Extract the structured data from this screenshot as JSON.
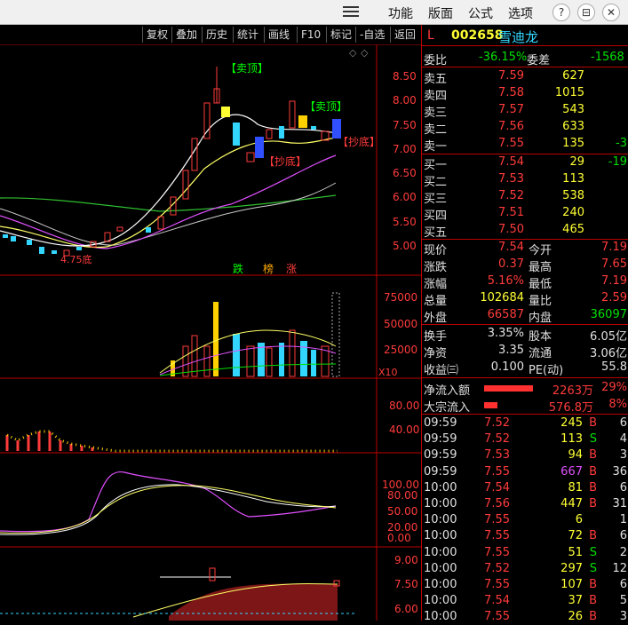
{
  "menu": {
    "items": [
      "功能",
      "版面",
      "公式",
      "选项"
    ],
    "window_buttons": [
      "?",
      "⊟",
      "⊠",
      "✕"
    ]
  },
  "toolbar": {
    "buttons": [
      "复权",
      "叠加",
      "历史",
      "统计",
      "画线",
      "F10",
      "标记",
      "-自选",
      "返回"
    ]
  },
  "stock": {
    "flag": "L",
    "code": "002658",
    "name": "雪迪龙"
  },
  "main_chart": {
    "y_ticks": [
      "8.50",
      "8.00",
      "7.50",
      "7.00",
      "6.50",
      "6.00",
      "5.50",
      "5.00"
    ],
    "annotations": {
      "sell_top_1": "【卖顶】",
      "sell_top_2": "【卖顶】",
      "buy_bottom_1": "【抄底】",
      "buy_bottom_2": "【抄底】",
      "low_mark": "4.75底"
    },
    "tags": [
      "跌",
      "榜",
      "涨"
    ]
  },
  "volume_chart": {
    "y_ticks": [
      "75000",
      "50000",
      "25000"
    ],
    "unit": "X10"
  },
  "indicator1": {
    "y_ticks": [
      "80.00",
      "40.00"
    ]
  },
  "indicator2": {
    "y_ticks": [
      "100.00",
      "80.00",
      "50.00",
      "20.00",
      "0.00"
    ]
  },
  "indicator3": {
    "y_ticks": [
      "9.00",
      "7.50",
      "6.00"
    ]
  },
  "quote": {
    "commission_ratio_label": "委比",
    "commission_ratio": "-36.15%",
    "commission_diff_label": "委差",
    "commission_diff": "-1568",
    "asks": [
      {
        "label": "卖五",
        "price": "7.59",
        "vol": "627",
        "chg": ""
      },
      {
        "label": "卖四",
        "price": "7.58",
        "vol": "1015",
        "chg": ""
      },
      {
        "label": "卖三",
        "price": "7.57",
        "vol": "543",
        "chg": ""
      },
      {
        "label": "卖二",
        "price": "7.56",
        "vol": "633",
        "chg": ""
      },
      {
        "label": "卖一",
        "price": "7.55",
        "vol": "135",
        "chg": "-3"
      }
    ],
    "bids": [
      {
        "label": "买一",
        "price": "7.54",
        "vol": "29",
        "chg": "-19"
      },
      {
        "label": "买二",
        "price": "7.53",
        "vol": "113",
        "chg": ""
      },
      {
        "label": "买三",
        "price": "7.52",
        "vol": "538",
        "chg": ""
      },
      {
        "label": "买四",
        "price": "7.51",
        "vol": "240",
        "chg": ""
      },
      {
        "label": "买五",
        "price": "7.50",
        "vol": "465",
        "chg": ""
      }
    ],
    "stats": [
      {
        "l1": "现价",
        "v1": "7.54",
        "l2": "今开",
        "v2": "7.19"
      },
      {
        "l1": "涨跌",
        "v1": "0.37",
        "l2": "最高",
        "v2": "7.65"
      },
      {
        "l1": "涨幅",
        "v1": "5.16%",
        "l2": "最低",
        "v2": "7.19"
      },
      {
        "l1": "总量",
        "v1": "102684",
        "l2": "量比",
        "v2": "2.59"
      },
      {
        "l1": "外盘",
        "v1": "66587",
        "l2": "内盘",
        "v2": "36097"
      }
    ],
    "stats2": [
      {
        "l1": "换手",
        "v1": "3.35%",
        "l2": "股本",
        "v2": "6.05亿"
      },
      {
        "l1": "净资",
        "v1": "3.35",
        "l2": "流通",
        "v2": "3.06亿"
      },
      {
        "l1": "收益㈢",
        "v1": "0.100",
        "l2": "PE(动)",
        "v2": "55.8"
      }
    ],
    "flows": [
      {
        "label": "净流入额",
        "value": "2263万",
        "pct": "29%",
        "bar": 0.29
      },
      {
        "label": "大宗流入",
        "value": "576.8万",
        "pct": "8%",
        "bar": 0.08
      }
    ],
    "ticks": [
      {
        "time": "09:59",
        "price": "7.52",
        "vol": "245",
        "bs": "B",
        "n": "6"
      },
      {
        "time": "09:59",
        "price": "7.52",
        "vol": "113",
        "bs": "S",
        "n": "4"
      },
      {
        "time": "09:59",
        "price": "7.53",
        "vol": "94",
        "bs": "B",
        "n": "3"
      },
      {
        "time": "09:59",
        "price": "7.55",
        "vol": "667",
        "bs": "B",
        "n": "36"
      },
      {
        "time": "10:00",
        "price": "7.54",
        "vol": "81",
        "bs": "B",
        "n": "6"
      },
      {
        "time": "10:00",
        "price": "7.56",
        "vol": "447",
        "bs": "B",
        "n": "31"
      },
      {
        "time": "10:00",
        "price": "7.55",
        "vol": "6",
        "bs": "",
        "n": "1"
      },
      {
        "time": "10:00",
        "price": "7.55",
        "vol": "72",
        "bs": "B",
        "n": "6"
      },
      {
        "time": "10:00",
        "price": "7.55",
        "vol": "51",
        "bs": "S",
        "n": "2"
      },
      {
        "time": "10:00",
        "price": "7.52",
        "vol": "297",
        "bs": "S",
        "n": "12"
      },
      {
        "time": "10:00",
        "price": "7.55",
        "vol": "107",
        "bs": "B",
        "n": "6"
      },
      {
        "time": "10:00",
        "price": "7.54",
        "vol": "37",
        "bs": "B",
        "n": "5"
      },
      {
        "time": "10:00",
        "price": "7.55",
        "vol": "26",
        "bs": "B",
        "n": "3"
      }
    ]
  },
  "colors": {
    "up": "#ff3b3b",
    "down": "#00e000",
    "price": "#ffff33",
    "border": "#b00000"
  }
}
